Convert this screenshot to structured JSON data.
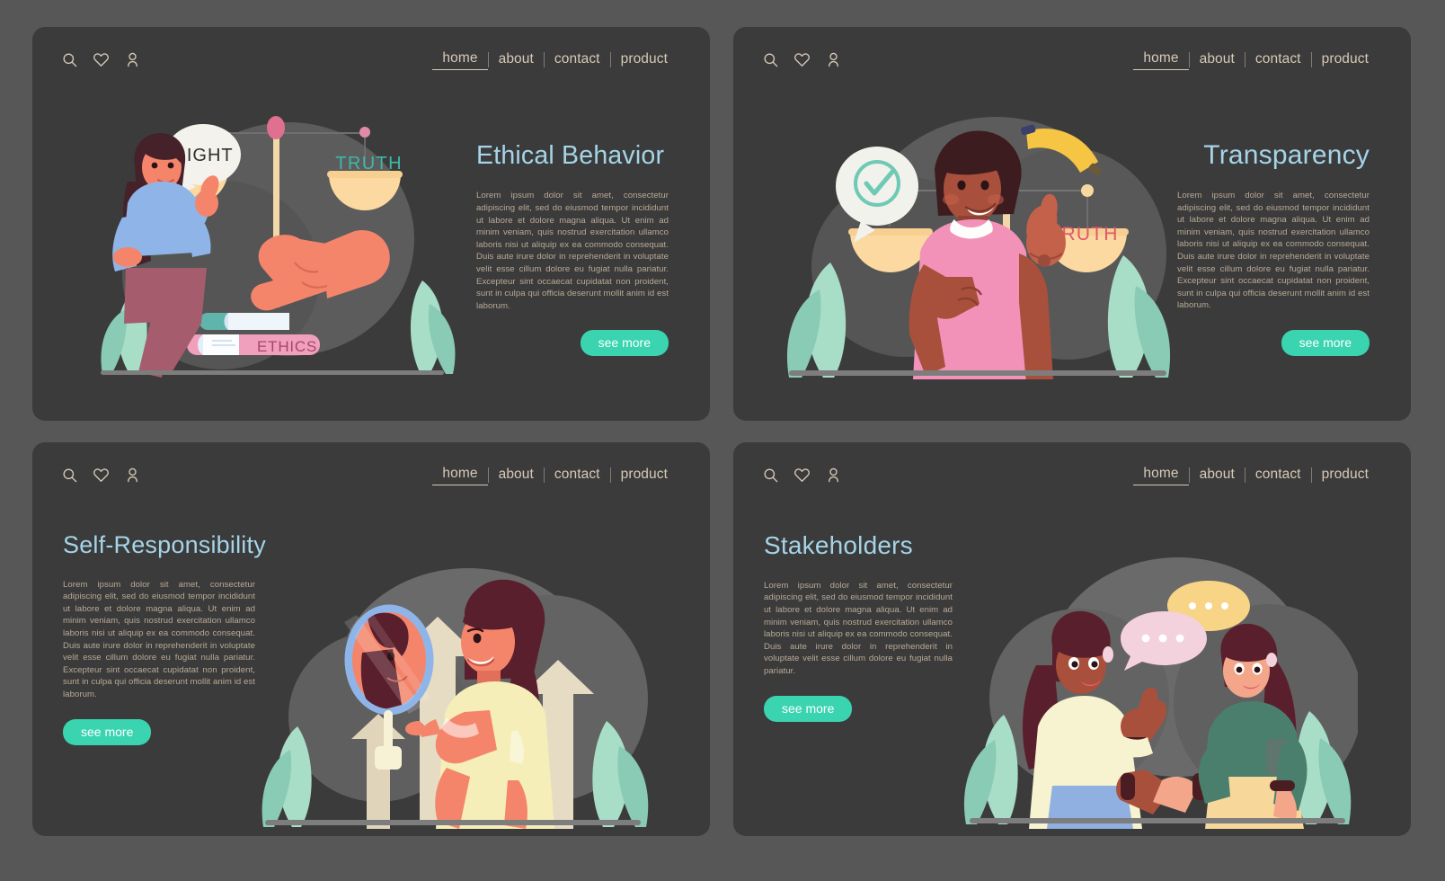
{
  "theme": {
    "page_bg": "#575757",
    "card_bg": "#3b3b3b",
    "title_color": "#a5d4e8",
    "body_color": "#b9aa97",
    "nav_color": "#d6c9b6",
    "button_color": "#3ad4b0",
    "button_text": "#ffffff"
  },
  "nav": {
    "icons": [
      {
        "name": "search-icon",
        "label": "search"
      },
      {
        "name": "heart-icon",
        "label": "favorites"
      },
      {
        "name": "user-icon",
        "label": "account"
      }
    ],
    "links": [
      {
        "label": "home",
        "active": true
      },
      {
        "label": "about",
        "active": false
      },
      {
        "label": "contact",
        "active": false
      },
      {
        "label": "product",
        "active": false
      }
    ]
  },
  "lorem_full": "Lorem ipsum dolor sit amet, consectetur adipiscing elit, sed do eiusmod tempor incididunt ut labore et dolore magna aliqua. Ut enim ad minim veniam, quis nostrud exercitation ullamco laboris nisi ut aliquip ex ea commodo consequat. Duis aute irure dolor in reprehenderit in voluptate velit esse cillum dolore eu fugiat nulla pariatur. Excepteur sint occaecat cupidatat non proident, sunt in culpa qui officia deserunt mollit anim id est laborum.",
  "lorem_short": "Lorem ipsum dolor sit amet, consectetur adipiscing elit, sed do eiusmod tempor incididunt ut labore et dolore magna aliqua. Ut enim ad minim veniam, quis nostrud exercitation ullamco laboris nisi ut aliquip ex ea commodo consequat. Duis aute irure dolor in reprehenderit in voluptate velit esse cillum dolore eu fugiat nulla pariatur.",
  "panels": [
    {
      "id": "ethical-behavior",
      "title": "Ethical Behavior",
      "layout": "illustration-left",
      "button_label": "see more",
      "illustration": {
        "name": "woman-with-justice-scales",
        "labels": {
          "speech_bubble": "RIGHT",
          "scale_label": "TRUTH",
          "book_label": "ETHICS"
        },
        "colors": {
          "sweater": "#8fb5e8",
          "pants": "#a55d6e",
          "skin": "#f4856b",
          "hair": "#45212a",
          "scale_bowl": "#f9d59b",
          "hand": "#f4856b",
          "book_top": "#5fb5ac",
          "book_bottom": "#f0a0bd",
          "leaf": "#a8ddc8",
          "blob": "#5c5c5c",
          "truth_text": "#3eb8a8",
          "ethics_text": "#c04f74"
        }
      }
    },
    {
      "id": "transparency",
      "title": "Transparency",
      "layout": "illustration-left",
      "button_label": "see more",
      "illustration": {
        "name": "man-with-hand-on-heart",
        "labels": {
          "scale_label": "TRUTH"
        },
        "colors": {
          "shirt": "#f292b8",
          "skin": "#a8503c",
          "skin_light": "#c4614a",
          "hair": "#3d1c1f",
          "check_bubble": "#f2f2ed",
          "check_mark": "#6fc9b5",
          "scale_bowl": "#f9d59b",
          "arc": "#f6c544",
          "leaf": "#a8ddc8",
          "blob": "#5c5c5c",
          "truth_text": "#e0576f"
        }
      }
    },
    {
      "id": "self-responsibility",
      "title": "Self-Responsibility",
      "layout": "illustration-right",
      "button_label": "see more",
      "illustration": {
        "name": "woman-with-mirror-and-arrows",
        "labels": {},
        "colors": {
          "top": "#f5eeb8",
          "skin": "#f4856b",
          "hair": "#5a1f2c",
          "mirror_glass": "#8fb5e8",
          "arrow": "#e6dcc4",
          "leaf": "#a8ddc8",
          "blob": "#6a6a6a"
        }
      }
    },
    {
      "id": "stakeholders",
      "title": "Stakeholders",
      "layout": "illustration-right",
      "button_label": "see more",
      "illustration": {
        "name": "two-women-shaking-hands",
        "labels": {},
        "colors": {
          "left_top": "#f7f2cf",
          "left_skirt": "#8fb0e0",
          "left_skin": "#a8503c",
          "right_top": "#4a7f6e",
          "right_pants": "#f7d79a",
          "right_skin": "#f4a68a",
          "hair_dark": "#5a1f2c",
          "bubble_yellow": "#f7d486",
          "bubble_pink": "#f4d2dd",
          "leaf": "#a8ddc8",
          "blob": "#6a6a6a"
        }
      }
    }
  ]
}
